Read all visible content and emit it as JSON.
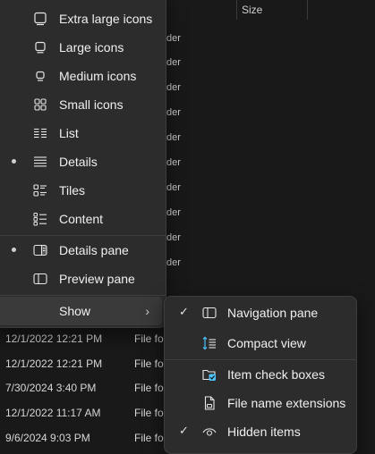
{
  "background": {
    "column_header": {
      "size_label": "Size"
    },
    "type_fragments": [
      "der",
      "der",
      "der",
      "der",
      "der",
      "der",
      "der",
      "der",
      "der",
      "der"
    ],
    "file_rows": [
      {
        "date": "12/1/2022 12:21 PM",
        "type": "File fo"
      },
      {
        "date": "12/1/2022 12:21 PM",
        "type": "File fo"
      },
      {
        "date": "7/30/2024 3:40 PM",
        "type": "File fo"
      },
      {
        "date": "12/1/2022 11:17 AM",
        "type": "File fo"
      },
      {
        "date": "9/6/2024 9:03 PM",
        "type": "File fo"
      }
    ]
  },
  "view_menu": {
    "items": [
      {
        "label": "Extra large icons",
        "icon": "extra-large-icons-icon"
      },
      {
        "label": "Large icons",
        "icon": "large-icons-icon"
      },
      {
        "label": "Medium icons",
        "icon": "medium-icons-icon"
      },
      {
        "label": "Small icons",
        "icon": "small-icons-icon"
      },
      {
        "label": "List",
        "icon": "list-icon"
      },
      {
        "label": "Details",
        "icon": "details-icon",
        "selected": true
      },
      {
        "label": "Tiles",
        "icon": "tiles-icon"
      },
      {
        "label": "Content",
        "icon": "content-icon"
      }
    ],
    "pane_items": [
      {
        "label": "Details pane",
        "icon": "details-pane-icon",
        "selected": true
      },
      {
        "label": "Preview pane",
        "icon": "preview-pane-icon"
      }
    ],
    "show": {
      "label": "Show",
      "chevron": "›"
    }
  },
  "show_submenu": {
    "items": [
      {
        "label": "Navigation pane",
        "icon": "navigation-pane-icon",
        "checked": true,
        "check": "✓"
      },
      {
        "label": "Compact view",
        "icon": "compact-view-icon",
        "checked": false
      },
      {
        "label": "Item check boxes",
        "icon": "item-check-boxes-icon",
        "checked": false
      },
      {
        "label": "File name extensions",
        "icon": "file-name-extensions-icon",
        "checked": false
      },
      {
        "label": "Hidden items",
        "icon": "hidden-items-icon",
        "checked": true,
        "check": "✓"
      }
    ]
  },
  "colors": {
    "accent": "#4cc2ff",
    "menu_bg": "#2c2c2c",
    "page_bg": "#191919"
  }
}
